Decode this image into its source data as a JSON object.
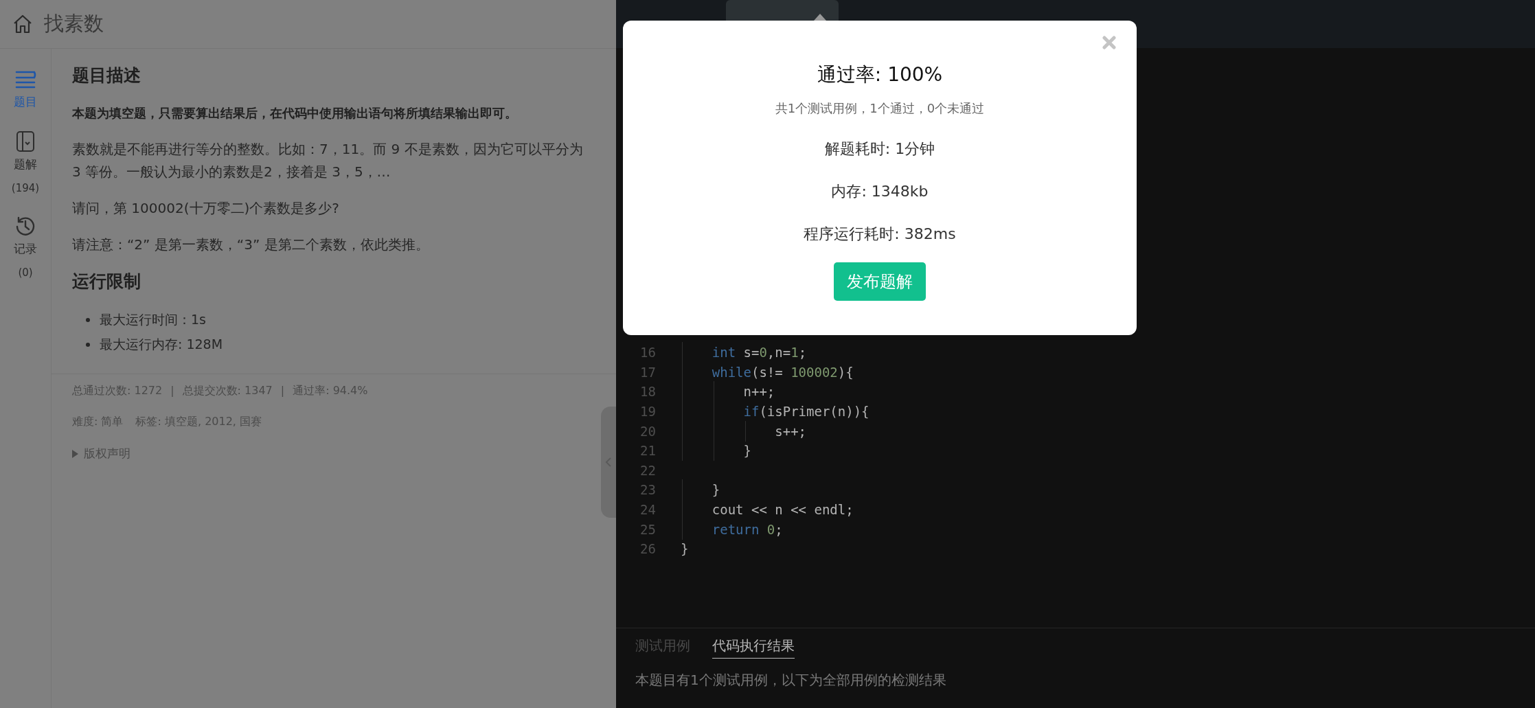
{
  "header": {
    "title": "找素数"
  },
  "sidebar": {
    "items": [
      {
        "kind": "problem",
        "label": "题目",
        "selected": true
      },
      {
        "kind": "solutions",
        "label": "题解",
        "count": "(194)",
        "selected": false
      },
      {
        "kind": "records",
        "label": "记录",
        "count": "(0)",
        "selected": false
      }
    ]
  },
  "problem": {
    "description_heading": "题目描述",
    "paragraphs": [
      {
        "kind": "bold",
        "text": "本题为填空题，只需要算出结果后，在代码中使用输出语句将所填结果输出即可。"
      },
      {
        "kind": "plain",
        "text": "素数就是不能再进行等分的整数。比如：7，11。而 9 不是素数，因为它可以平分为 3 等份。一般认为最小的素数是2，接着是 3，5，…"
      },
      {
        "kind": "plain",
        "text": "请问，第 100002(十万零二)个素数是多少?"
      },
      {
        "kind": "plain",
        "text": "请注意：“2” 是第一素数，“3” 是第二个素数，依此类推。"
      }
    ],
    "limits_heading": "运行限制",
    "limits": [
      "最大运行时间：1s",
      "最大运行内存: 128M"
    ],
    "stats": [
      "总通过次数: 1272",
      "|",
      "总提交次数: 1347",
      "|",
      "通过率: 94.4%"
    ],
    "meta": [
      "难度: 简单",
      "标签: 填空题, 2012, 国赛"
    ],
    "copyright": {
      "label": "版权声明",
      "expanded": false
    }
  },
  "editor": {
    "lines": [
      {
        "number": "16",
        "tokens": [
          {
            "kind": "keyword",
            "text": "    int"
          },
          {
            "kind": "plain",
            "text": " s="
          },
          {
            "kind": "number",
            "text": "0"
          },
          {
            "kind": "plain",
            "text": ",n="
          },
          {
            "kind": "number",
            "text": "1"
          },
          {
            "kind": "plain",
            "text": ";"
          }
        ]
      },
      {
        "number": "17",
        "tokens": [
          {
            "kind": "keyword",
            "text": "    while"
          },
          {
            "kind": "plain",
            "text": "(s!= "
          },
          {
            "kind": "number",
            "text": "100002"
          },
          {
            "kind": "plain",
            "text": "){"
          }
        ]
      },
      {
        "number": "18",
        "tokens": [
          {
            "kind": "plain",
            "text": "        n++;"
          }
        ]
      },
      {
        "number": "19",
        "tokens": [
          {
            "kind": "keyword",
            "text": "        if"
          },
          {
            "kind": "plain",
            "text": "(isPrimer(n)){"
          }
        ]
      },
      {
        "number": "20",
        "tokens": [
          {
            "kind": "plain",
            "text": "            s++;"
          }
        ]
      },
      {
        "number": "21",
        "tokens": [
          {
            "kind": "plain",
            "text": "        }"
          }
        ]
      },
      {
        "number": "22"
      },
      {
        "number": "23",
        "tokens": [
          {
            "kind": "plain",
            "text": "    }"
          }
        ]
      },
      {
        "number": "24",
        "tokens": [
          {
            "kind": "plain",
            "text": "    cout << n << endl;"
          }
        ]
      },
      {
        "number": "25",
        "tokens": [
          {
            "kind": "keyword",
            "text": "    return"
          },
          {
            "kind": "number",
            "text": " 0"
          },
          {
            "kind": "plain",
            "text": ";"
          }
        ]
      },
      {
        "number": "26",
        "tokens": [
          {
            "kind": "plain",
            "text": "}"
          }
        ]
      }
    ]
  },
  "result_panel": {
    "tabs": [
      {
        "label": "测试用例",
        "selected": false
      },
      {
        "label": "代码执行结果",
        "selected": true
      }
    ],
    "message": "本题目有1个测试用例，以下为全部用例的检测结果"
  },
  "dialog": {
    "title": "通过率: 100%",
    "summary": "共1个测试用例，1个通过，0个未通过",
    "rows": [
      "解题耗时: 1分钟",
      "内存: 1348kb",
      "程序运行耗时: 382ms"
    ],
    "button": "发布题解"
  }
}
